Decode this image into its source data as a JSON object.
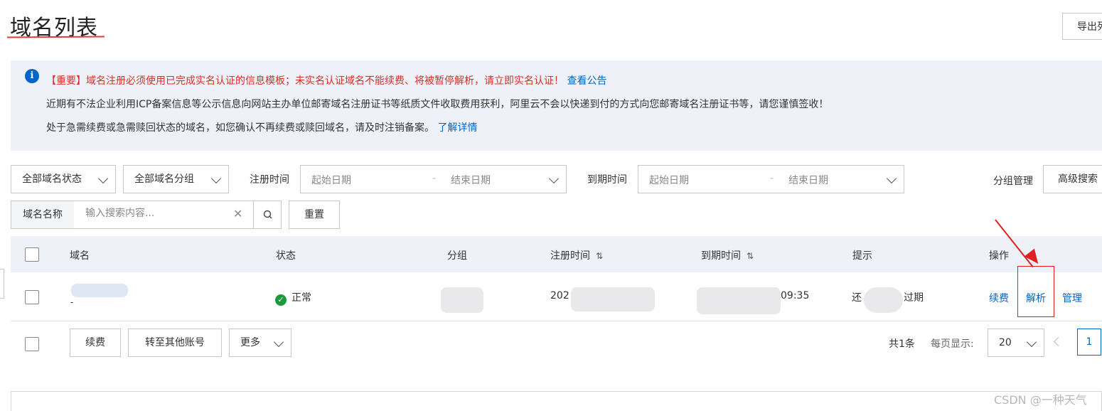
{
  "page": {
    "title": "域名列表",
    "export_label": "导出列"
  },
  "notice": {
    "line1_text": "【重要】域名注册必须使用已完成实名认证的信息模板；未实名认证域名不能续费、将被暂停解析，请立即实名认证！",
    "line1_link": "查看公告",
    "line2_text": "近期有不法企业利用ICP备案信息等公示信息向网站主办单位邮寄域名注册证书等纸质文件收取费用获利，阿里云不会以快递到付的方式向您邮寄域名注册证书等，请您谨慎签收！",
    "line3_text": "处于急需续费或急需赎回状态的域名，如您确认不再续费或赎回域名，请及时注销备案。",
    "line3_link": "了解详情"
  },
  "filters": {
    "status_select": "全部域名状态",
    "group_select": "全部域名分组",
    "reg_time_label": "注册时间",
    "expire_time_label": "到期时间",
    "start_date_placeholder": "起始日期",
    "end_date_placeholder": "结束日期",
    "date_separator": "-",
    "group_manage": "分组管理",
    "advanced_search": "高级搜索"
  },
  "search": {
    "label": "域名名称",
    "placeholder": "输入搜索内容...",
    "reset_label": "重置"
  },
  "table": {
    "headers": {
      "domain": "域名",
      "status": "状态",
      "group": "分组",
      "reg_time": "注册时间",
      "expire_time": "到期时间",
      "tip": "提示",
      "actions": "操作"
    },
    "sort_glyph": "⇅",
    "rows": [
      {
        "domain_sub": "-",
        "status": "正常",
        "reg_time_prefix": "202",
        "expire_time_suffix": "09:35",
        "tip_prefix": "还",
        "tip_suffix": "过期",
        "actions": [
          "续费",
          "解析",
          "管理"
        ]
      }
    ]
  },
  "footer": {
    "renew_label": "续费",
    "transfer_label": "转至其他账号",
    "more_label": "更多",
    "total_text": "共1条",
    "per_page_label": "每页显示:",
    "per_page_value": "20",
    "current_page": "1"
  },
  "watermark": "CSDN @一种天气",
  "colors": {
    "accent": "#0064c8",
    "alert": "#d93026",
    "annotation": "#e02020",
    "success": "#1a9a3c"
  }
}
